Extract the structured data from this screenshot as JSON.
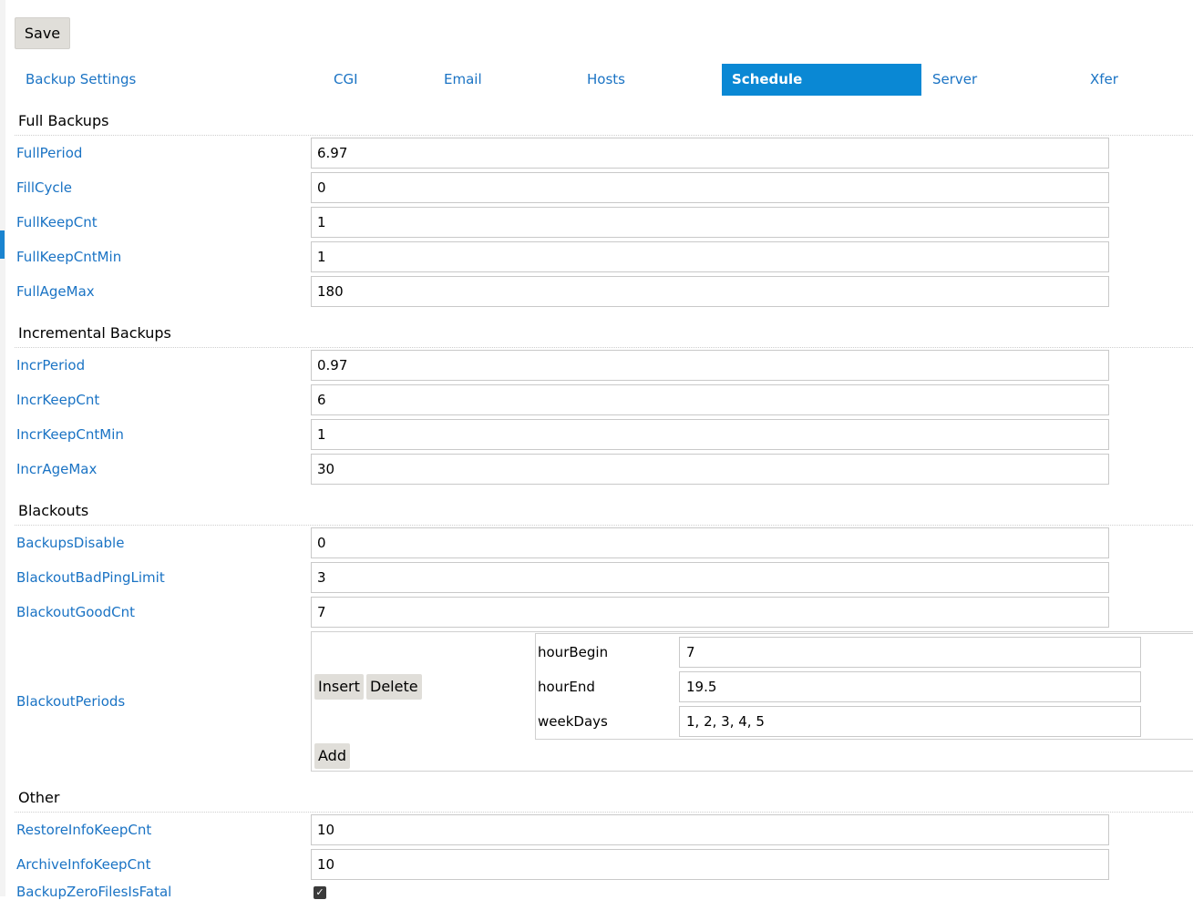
{
  "toolbar": {
    "save_label": "Save"
  },
  "tabs": [
    {
      "label": "Backup Settings",
      "active": false
    },
    {
      "label": "CGI",
      "active": false
    },
    {
      "label": "Email",
      "active": false
    },
    {
      "label": "Hosts",
      "active": false
    },
    {
      "label": "Schedule",
      "active": true
    },
    {
      "label": "Server",
      "active": false
    },
    {
      "label": "Xfer",
      "active": false
    }
  ],
  "sections": {
    "full": {
      "title": "Full Backups",
      "fields": [
        {
          "label": "FullPeriod",
          "value": "6.97"
        },
        {
          "label": "FillCycle",
          "value": "0"
        },
        {
          "label": "FullKeepCnt",
          "value": "1"
        },
        {
          "label": "FullKeepCntMin",
          "value": "1"
        },
        {
          "label": "FullAgeMax",
          "value": "180"
        }
      ]
    },
    "incr": {
      "title": "Incremental Backups",
      "fields": [
        {
          "label": "IncrPeriod",
          "value": "0.97"
        },
        {
          "label": "IncrKeepCnt",
          "value": "6"
        },
        {
          "label": "IncrKeepCntMin",
          "value": "1"
        },
        {
          "label": "IncrAgeMax",
          "value": "30"
        }
      ]
    },
    "blackouts": {
      "title": "Blackouts",
      "fields": [
        {
          "label": "BackupsDisable",
          "value": "0"
        },
        {
          "label": "BlackoutBadPingLimit",
          "value": "3"
        },
        {
          "label": "BlackoutGoodCnt",
          "value": "7"
        }
      ],
      "periods": {
        "label": "BlackoutPeriods",
        "insert_label": "Insert",
        "delete_label": "Delete",
        "add_label": "Add",
        "entries": [
          {
            "label": "hourBegin",
            "value": "7"
          },
          {
            "label": "hourEnd",
            "value": "19.5"
          },
          {
            "label": "weekDays",
            "value": "1, 2, 3, 4, 5"
          }
        ]
      }
    },
    "other": {
      "title": "Other",
      "fields": [
        {
          "label": "RestoreInfoKeepCnt",
          "value": "10"
        },
        {
          "label": "ArchiveInfoKeepCnt",
          "value": "10"
        }
      ],
      "checkbox_field": {
        "label": "BackupZeroFilesIsFatal",
        "checked": true
      }
    }
  },
  "colors": {
    "link": "#1a73c4",
    "active_tab": "#0a88d4",
    "button_bg": "#e0ded9"
  }
}
